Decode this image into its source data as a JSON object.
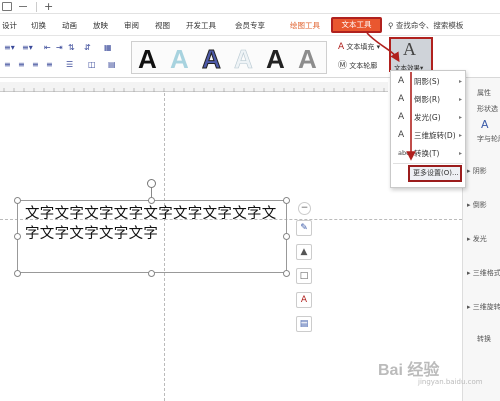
{
  "menu_tabs": [
    {
      "label": "设计"
    },
    {
      "label": "切换"
    },
    {
      "label": "动画"
    },
    {
      "label": "放映"
    },
    {
      "label": "审阅"
    },
    {
      "label": "视图"
    },
    {
      "label": "开发工具"
    },
    {
      "label": "会员专享"
    },
    {
      "label": "绘图工具"
    },
    {
      "label": "文本工具"
    }
  ],
  "search": {
    "label": "查找命令、搜索模板"
  },
  "ribbon": {
    "text_fill_label": "文本填充",
    "text_outline_label": "文本轮廓",
    "text_effects_label": "文本效果",
    "gallery_letter": "A"
  },
  "effects_menu": {
    "items": [
      {
        "icon": "A",
        "label": "阴影(S)"
      },
      {
        "icon": "A",
        "label": "倒影(R)"
      },
      {
        "icon": "A",
        "label": "发光(G)"
      },
      {
        "icon": "A",
        "label": "三维旋转(D)"
      },
      {
        "icon": "abc",
        "label": "转换(T)"
      }
    ],
    "more_settings": "更多设置(O)..."
  },
  "textbox": {
    "text": "文字文字文字文字文字文字文字文字文字文字文字文字文字"
  },
  "right_pane": {
    "items": [
      "属性",
      "形状选",
      "字与轮廓",
      "阴影",
      "倒影",
      "发光",
      "三维格式",
      "三维旋转",
      "转换"
    ]
  },
  "watermark": {
    "brand": "Bai 经验",
    "url": "jingyan.baidu.com"
  },
  "colors": {
    "accent": "#e9572f",
    "annotation": "#b0211e"
  }
}
